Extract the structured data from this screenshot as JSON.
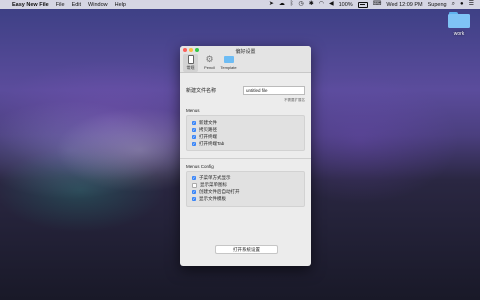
{
  "menubar": {
    "apple": "",
    "app_name": "Easy New File",
    "menus": [
      "File",
      "Edit",
      "Window",
      "Help"
    ],
    "battery_percent": "100%",
    "clock": "Wed 12:09 PM",
    "user": "Supeng"
  },
  "desktop": {
    "folder_label": "work"
  },
  "window": {
    "title": "偏好设置",
    "tabs": [
      {
        "label": "常规",
        "icon": "device-icon"
      },
      {
        "label": "Pencil",
        "icon": "gear-icon"
      },
      {
        "label": "Template",
        "icon": "folder-icon"
      }
    ],
    "filename_label": "新建文件名称",
    "filename_value": "untitled file",
    "filename_hint": "不需要扩展名",
    "menus_section": {
      "title": "Menus",
      "items": [
        {
          "label": "新建文件",
          "checked": true
        },
        {
          "label": "拷贝路径",
          "checked": true
        },
        {
          "label": "打开终端",
          "checked": true
        },
        {
          "label": "打开终端Tab",
          "checked": true
        }
      ]
    },
    "config_section": {
      "title": "Menus Config",
      "items": [
        {
          "label": "子菜单方式显示",
          "checked": true
        },
        {
          "label": "显示菜单图标",
          "checked": false
        },
        {
          "label": "创建文件后自动打开",
          "checked": true
        },
        {
          "label": "显示文件模板",
          "checked": true
        }
      ]
    },
    "open_settings_button": "打开系统设置"
  },
  "colors": {
    "accent": "#3b86f7",
    "close": "#fc605c",
    "minimize": "#fdbc40",
    "maximize": "#34c84a"
  }
}
